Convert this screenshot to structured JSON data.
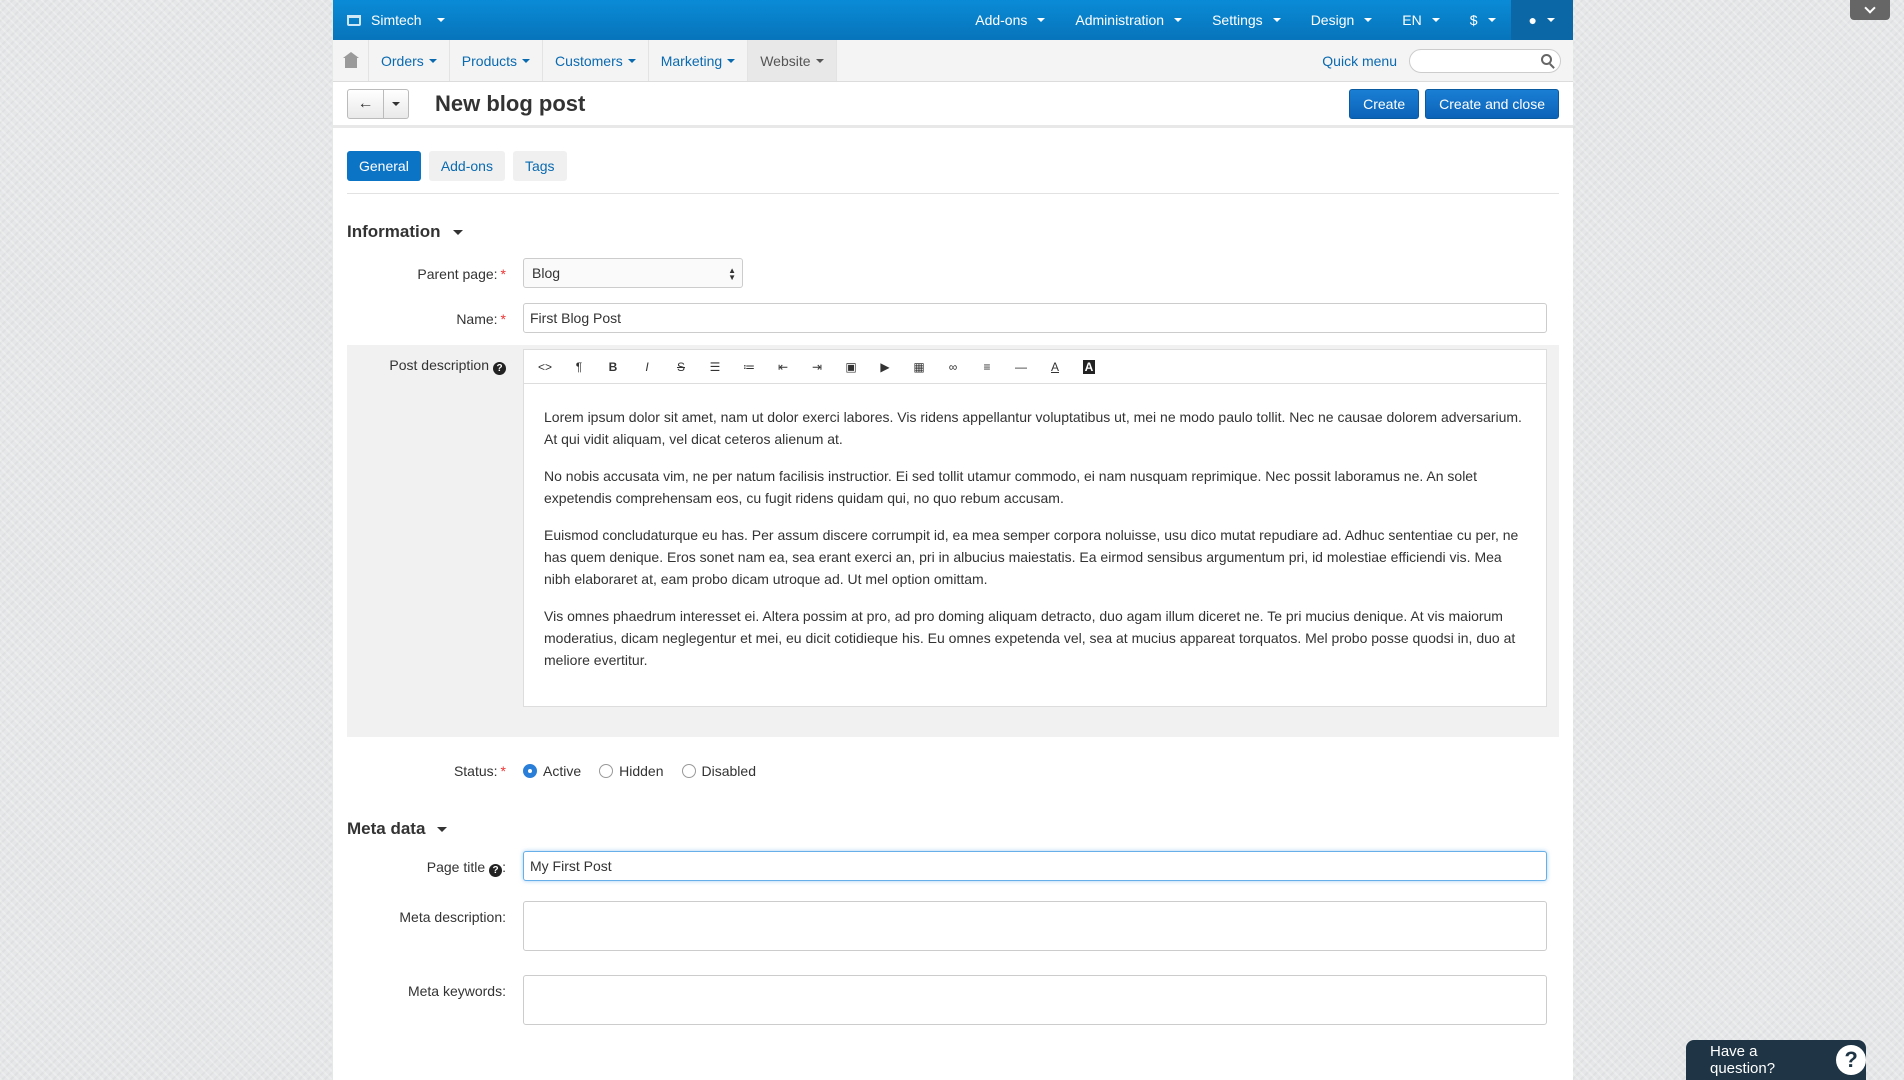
{
  "topbar": {
    "store": "Simtech",
    "menus": [
      "Add-ons",
      "Administration",
      "Settings",
      "Design",
      "EN",
      "$"
    ]
  },
  "navbar": {
    "items": [
      "Orders",
      "Products",
      "Customers",
      "Marketing",
      "Website"
    ],
    "quick_menu": "Quick menu",
    "search_placeholder": ""
  },
  "header": {
    "title": "New blog post",
    "create": "Create",
    "create_close": "Create and close"
  },
  "tabs": [
    "General",
    "Add-ons",
    "Tags"
  ],
  "information": {
    "title": "Information",
    "parent_label": "Parent page:",
    "parent_value": "Blog",
    "name_label": "Name:",
    "name_value": "First Blog Post",
    "desc_label": "Post description",
    "paragraphs": [
      "Lorem ipsum dolor sit amet, nam ut dolor exerci labores. Vis ridens appellantur voluptatibus ut, mei ne modo paulo tollit. Nec ne causae dolorem adversarium. At qui vidit aliquam, vel dicat ceteros alienum at.",
      "No nobis accusata vim, ne per natum facilisis instructior. Ei sed tollit utamur commodo, ei nam nusquam reprimique. Nec possit laboramus ne. An solet expetendis comprehensam eos, cu fugit ridens quidam qui, no quo rebum accusam.",
      "Euismod concludaturque eu has. Per assum discere corrumpit id, ea mea semper corpora noluisse, usu dico mutat repudiare ad. Adhuc sententiae cu per, ne has quem denique. Eros sonet nam ea, sea erant exerci an, pri in albucius maiestatis. Ea eirmod sensibus argumentum pri, id molestiae efficiendi vis. Mea nibh elaboraret at, eam probo dicam utroque ad. Ut mel option omittam.",
      "Vis omnes phaedrum interesset ei. Altera possim at pro, ad pro doming aliquam detracto, duo agam illum diceret ne. Te pri mucius denique. At vis maiorum moderatius, dicam neglegentur et mei, eu dicit cotidieque his. Eu omnes expetenda vel, sea at mucius appareat torquatos. Mel probo posse quodsi in, duo at meliore evertitur."
    ],
    "status_label": "Status:",
    "status_options": [
      "Active",
      "Hidden",
      "Disabled"
    ],
    "status_selected": "Active"
  },
  "meta": {
    "title": "Meta data",
    "page_title_label": "Page title",
    "page_title_value": "My First Post",
    "meta_desc_label": "Meta description:",
    "meta_keywords_label": "Meta keywords:"
  },
  "help": {
    "label": "Have a question?"
  },
  "colors": {
    "topbar": "#0a7fc8",
    "primary": "#0b6ec0",
    "chat": "#1f3546"
  }
}
